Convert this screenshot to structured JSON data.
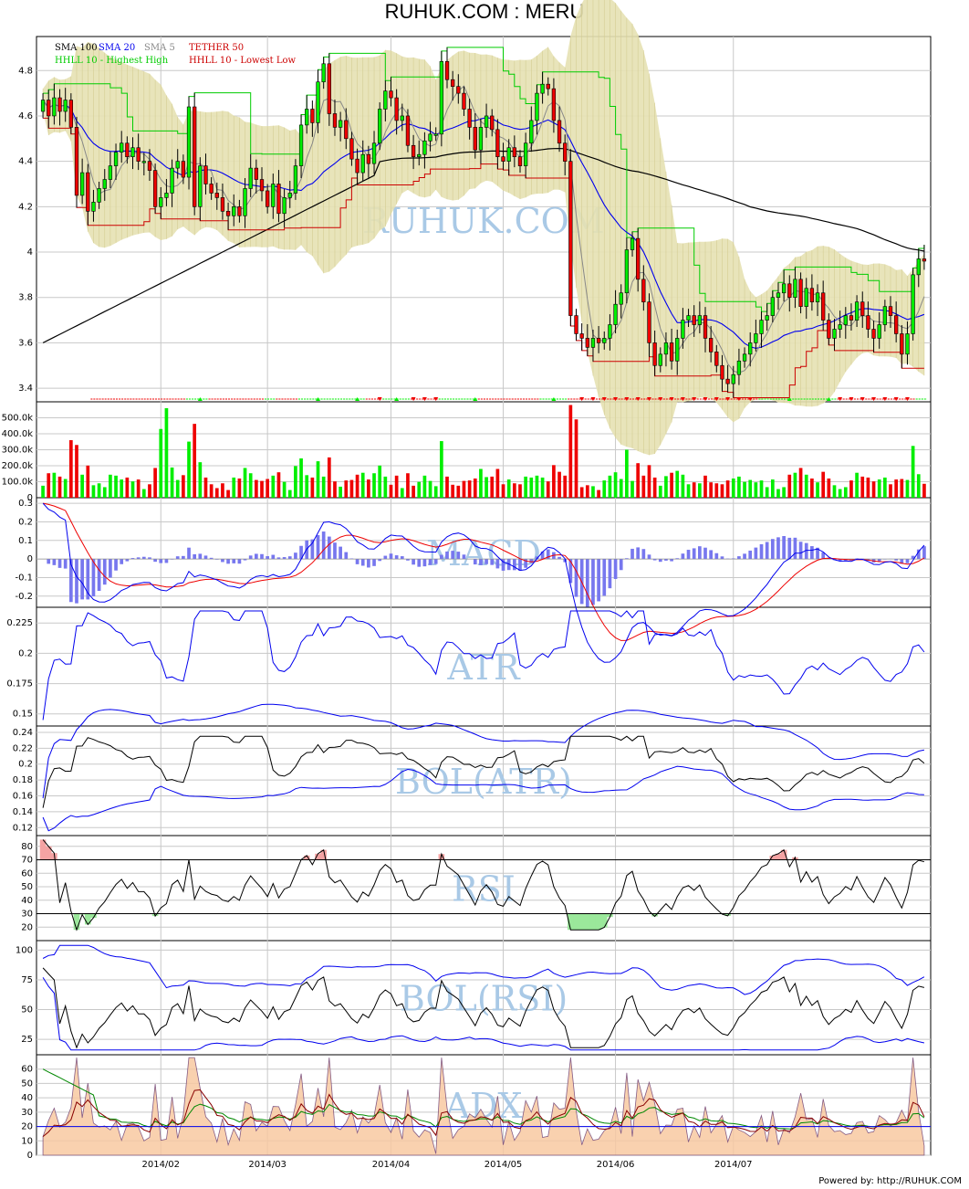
{
  "title": "RUHUK.COM : MERU",
  "footer": "Powered by: http://RUHUK.COM",
  "colors": {
    "up": "#00ee00",
    "down": "#ee0000",
    "band": "#e6e1b2",
    "sma100": "#000000",
    "sma20": "#0000ee",
    "sma5": "#888888",
    "hhll_high": "#00cc00",
    "hhll_low": "#cc0000"
  },
  "chart_data": [
    {
      "panel": "price",
      "type": "candlestick",
      "watermark": "RUHUK.COM",
      "legend": [
        "SMA 100",
        "SMA 20",
        "SMA 5",
        "TETHER 50",
        "HHLL 10 - Highest High",
        "HHLL 10 - Lowest Low"
      ],
      "ylim": [
        3.34,
        4.95
      ],
      "yticks": [
        "3.4",
        "3.6",
        "3.8",
        "4",
        "4.2",
        "4.4",
        "4.6",
        "4.8"
      ],
      "candles": [
        [
          4.62,
          4.67
        ],
        [
          4.67,
          4.6
        ],
        [
          4.6,
          4.68
        ],
        [
          4.68,
          4.62
        ],
        [
          4.62,
          4.67
        ],
        [
          4.67,
          4.55
        ],
        [
          4.55,
          4.25
        ],
        [
          4.25,
          4.35
        ],
        [
          4.35,
          4.18
        ],
        [
          4.18,
          4.22
        ],
        [
          4.22,
          4.28
        ],
        [
          4.28,
          4.32
        ],
        [
          4.32,
          4.38
        ],
        [
          4.38,
          4.44
        ],
        [
          4.44,
          4.48
        ],
        [
          4.48,
          4.42
        ],
        [
          4.42,
          4.46
        ],
        [
          4.46,
          4.4
        ],
        [
          4.4,
          4.4
        ],
        [
          4.4,
          4.36
        ],
        [
          4.36,
          4.2
        ],
        [
          4.2,
          4.24
        ],
        [
          4.24,
          4.26
        ],
        [
          4.26,
          4.37
        ],
        [
          4.37,
          4.4
        ],
        [
          4.4,
          4.33
        ],
        [
          4.33,
          4.64
        ],
        [
          4.64,
          4.2
        ],
        [
          4.2,
          4.38
        ],
        [
          4.38,
          4.3
        ],
        [
          4.3,
          4.26
        ],
        [
          4.26,
          4.24
        ],
        [
          4.24,
          4.18
        ],
        [
          4.18,
          4.16
        ],
        [
          4.16,
          4.2
        ],
        [
          4.2,
          4.16
        ],
        [
          4.16,
          4.28
        ],
        [
          4.28,
          4.37
        ],
        [
          4.37,
          4.32
        ],
        [
          4.32,
          4.27
        ],
        [
          4.27,
          4.2
        ],
        [
          4.2,
          4.3
        ],
        [
          4.3,
          4.17
        ],
        [
          4.17,
          4.24
        ],
        [
          4.24,
          4.26
        ],
        [
          4.26,
          4.38
        ],
        [
          4.38,
          4.56
        ],
        [
          4.56,
          4.63
        ],
        [
          4.63,
          4.57
        ],
        [
          4.57,
          4.75
        ],
        [
          4.75,
          4.83
        ],
        [
          4.83,
          4.61
        ],
        [
          4.61,
          4.55
        ],
        [
          4.55,
          4.58
        ],
        [
          4.58,
          4.5
        ],
        [
          4.5,
          4.41
        ],
        [
          4.41,
          4.35
        ],
        [
          4.35,
          4.43
        ],
        [
          4.43,
          4.39
        ],
        [
          4.39,
          4.48
        ],
        [
          4.48,
          4.63
        ],
        [
          4.63,
          4.71
        ],
        [
          4.71,
          4.68
        ],
        [
          4.68,
          4.58
        ],
        [
          4.58,
          4.6
        ],
        [
          4.6,
          4.47
        ],
        [
          4.47,
          4.42
        ],
        [
          4.42,
          4.43
        ],
        [
          4.43,
          4.49
        ],
        [
          4.49,
          4.52
        ],
        [
          4.52,
          4.52
        ],
        [
          4.52,
          4.84
        ],
        [
          4.84,
          4.76
        ],
        [
          4.76,
          4.73
        ],
        [
          4.73,
          4.7
        ],
        [
          4.7,
          4.63
        ],
        [
          4.63,
          4.55
        ],
        [
          4.55,
          4.45
        ],
        [
          4.45,
          4.55
        ],
        [
          4.55,
          4.6
        ],
        [
          4.6,
          4.54
        ],
        [
          4.54,
          4.42
        ],
        [
          4.42,
          4.4
        ],
        [
          4.4,
          4.46
        ],
        [
          4.46,
          4.42
        ],
        [
          4.42,
          4.38
        ],
        [
          4.38,
          4.48
        ],
        [
          4.48,
          4.58
        ],
        [
          4.58,
          4.7
        ],
        [
          4.7,
          4.74
        ],
        [
          4.74,
          4.72
        ],
        [
          4.72,
          4.58
        ],
        [
          4.58,
          4.48
        ],
        [
          4.48,
          4.4
        ],
        [
          4.4,
          3.72
        ],
        [
          3.72,
          3.64
        ],
        [
          3.64,
          3.62
        ],
        [
          3.62,
          3.58
        ],
        [
          3.58,
          3.62
        ],
        [
          3.62,
          3.6
        ],
        [
          3.6,
          3.62
        ],
        [
          3.62,
          3.68
        ],
        [
          3.68,
          3.77
        ],
        [
          3.77,
          3.82
        ],
        [
          3.82,
          4.01
        ],
        [
          4.01,
          4.06
        ],
        [
          4.06,
          3.88
        ],
        [
          3.88,
          3.78
        ],
        [
          3.78,
          3.6
        ],
        [
          3.6,
          3.5
        ],
        [
          3.5,
          3.55
        ],
        [
          3.55,
          3.6
        ],
        [
          3.6,
          3.52
        ],
        [
          3.52,
          3.62
        ],
        [
          3.62,
          3.7
        ],
        [
          3.7,
          3.72
        ],
        [
          3.72,
          3.68
        ],
        [
          3.68,
          3.72
        ],
        [
          3.72,
          3.62
        ],
        [
          3.62,
          3.56
        ],
        [
          3.56,
          3.5
        ],
        [
          3.5,
          3.44
        ],
        [
          3.44,
          3.42
        ],
        [
          3.42,
          3.46
        ],
        [
          3.46,
          3.52
        ],
        [
          3.52,
          3.55
        ],
        [
          3.55,
          3.6
        ],
        [
          3.6,
          3.64
        ],
        [
          3.64,
          3.7
        ],
        [
          3.7,
          3.72
        ],
        [
          3.72,
          3.8
        ],
        [
          3.8,
          3.82
        ],
        [
          3.82,
          3.86
        ],
        [
          3.86,
          3.8
        ],
        [
          3.8,
          3.88
        ],
        [
          3.88,
          3.76
        ],
        [
          3.76,
          3.84
        ],
        [
          3.84,
          3.78
        ],
        [
          3.78,
          3.82
        ],
        [
          3.82,
          3.7
        ],
        [
          3.7,
          3.62
        ],
        [
          3.62,
          3.66
        ],
        [
          3.66,
          3.68
        ],
        [
          3.68,
          3.72
        ],
        [
          3.72,
          3.7
        ],
        [
          3.7,
          3.78
        ],
        [
          3.78,
          3.72
        ],
        [
          3.72,
          3.66
        ],
        [
          3.66,
          3.62
        ],
        [
          3.62,
          3.68
        ],
        [
          3.68,
          3.76
        ],
        [
          3.76,
          3.72
        ],
        [
          3.72,
          3.64
        ],
        [
          3.64,
          3.55
        ],
        [
          3.55,
          3.64
        ],
        [
          3.64,
          3.9
        ],
        [
          3.9,
          3.97
        ],
        [
          3.97,
          3.96
        ]
      ]
    },
    {
      "panel": "volume",
      "type": "bar",
      "ylim": [
        0,
        600000
      ],
      "yticks": [
        "0",
        "100.0k",
        "200.0k",
        "300.0k",
        "400.0k",
        "500.0k"
      ]
    },
    {
      "panel": "macd",
      "type": "line",
      "watermark": "MACD",
      "ylim": [
        -0.26,
        0.33
      ],
      "yticks": [
        "-0.2",
        "-0.1",
        "0",
        "0.1",
        "0.2",
        "0.3"
      ]
    },
    {
      "panel": "atr",
      "type": "line",
      "watermark": "ATR",
      "ylim": [
        0.14,
        0.238
      ],
      "yticks": [
        "0.15",
        "0.175",
        "0.2",
        "0.225"
      ]
    },
    {
      "panel": "bol_atr",
      "type": "line",
      "watermark": "BOL(ATR)",
      "ylim": [
        0.11,
        0.248
      ],
      "yticks": [
        "0.12",
        "0.14",
        "0.16",
        "0.18",
        "0.2",
        "0.22",
        "0.24"
      ]
    },
    {
      "panel": "rsi",
      "type": "line",
      "watermark": "RSI",
      "ylim": [
        10,
        88
      ],
      "yticks": [
        "20",
        "30",
        "40",
        "50",
        "60",
        "70",
        "80"
      ],
      "levels": [
        30,
        70
      ]
    },
    {
      "panel": "bol_rsi",
      "type": "line",
      "watermark": "BOL(RSI)",
      "ylim": [
        12,
        108
      ],
      "yticks": [
        "25",
        "50",
        "75",
        "100"
      ]
    },
    {
      "panel": "adx",
      "type": "area",
      "watermark": "ADX",
      "ylim": [
        0,
        70
      ],
      "yticks": [
        "0",
        "10",
        "20",
        "30",
        "40",
        "50",
        "60"
      ]
    }
  ],
  "xaxis": {
    "labels": [
      "2014/02",
      "2014/03",
      "2014/04",
      "2014/05",
      "2014/06",
      "2014/07"
    ]
  }
}
